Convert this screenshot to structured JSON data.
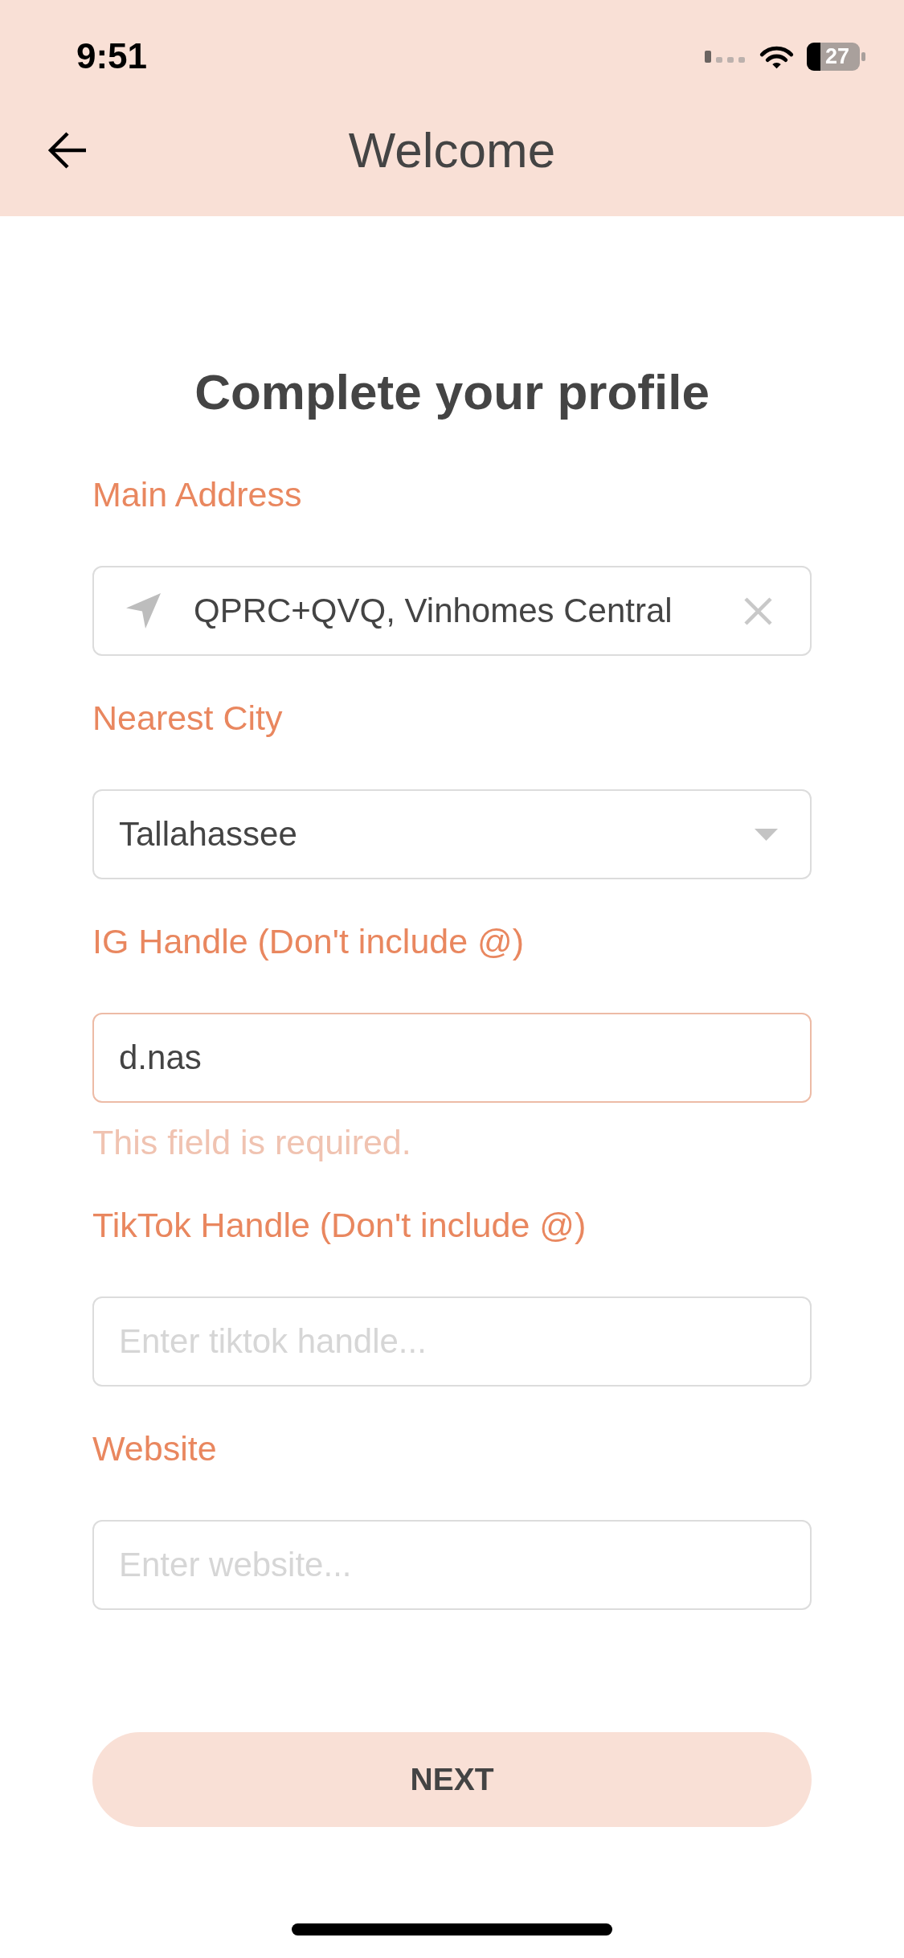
{
  "status_bar": {
    "time": "9:51",
    "battery": "27"
  },
  "header": {
    "title": "Welcome"
  },
  "form": {
    "title": "Complete your profile",
    "fields": [
      {
        "kind": "location",
        "label": "Main Address",
        "value": "QPRC+QVQ, Vinhomes Central",
        "invalid": false
      },
      {
        "kind": "select",
        "label": "Nearest City",
        "value": "Tallahassee",
        "invalid": false
      },
      {
        "kind": "text",
        "label": "IG Handle (Don't include @)",
        "value": "d.nas",
        "invalid": true,
        "error": "This field is required."
      },
      {
        "kind": "text",
        "label": "TikTok Handle (Don't include @)",
        "placeholder": "Enter tiktok handle...",
        "invalid": false
      },
      {
        "kind": "text",
        "label": "Website",
        "placeholder": "Enter website...",
        "invalid": false
      }
    ],
    "submit": {
      "label": "NEXT"
    }
  }
}
